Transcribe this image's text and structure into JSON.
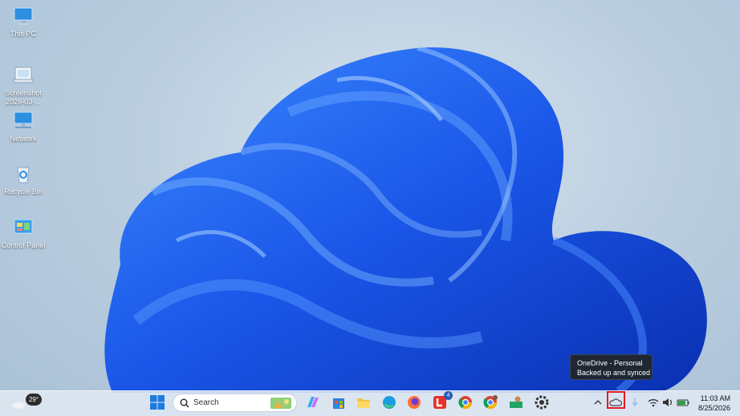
{
  "desktop": {
    "icons": [
      {
        "label": "This PC",
        "icon": "monitor-icon"
      },
      {
        "label": "Screenshot 2026-03-...",
        "icon": "screenshot-file-icon"
      },
      {
        "label": "Network",
        "icon": "network-icon"
      },
      {
        "label": "Recycle Bin",
        "icon": "recycle-bin-icon"
      },
      {
        "label": "Control Panel",
        "icon": "control-panel-icon"
      }
    ]
  },
  "tooltip": {
    "title": "OneDrive - Personal",
    "status": "Backed up and synced"
  },
  "taskbar": {
    "weather_temp": "29°",
    "search_placeholder": "Search",
    "apps": [
      {
        "name": "start",
        "icon": "windows-icon"
      },
      {
        "name": "copilot",
        "icon": "copilot-icon"
      },
      {
        "name": "store",
        "icon": "store-icon"
      },
      {
        "name": "file-explorer",
        "icon": "folder-icon"
      },
      {
        "name": "edge",
        "icon": "edge-icon"
      },
      {
        "name": "firefox",
        "icon": "firefox-icon"
      },
      {
        "name": "app-l",
        "icon": "l-app-icon",
        "badge": "4"
      },
      {
        "name": "chrome",
        "icon": "chrome-icon"
      },
      {
        "name": "chrome-profile",
        "icon": "chrome-profile-icon"
      },
      {
        "name": "app-person",
        "icon": "person-app-icon"
      },
      {
        "name": "settings",
        "icon": "settings-icon"
      }
    ],
    "clock": {
      "time": "11:03 AM",
      "date": "8/25/2026"
    }
  }
}
